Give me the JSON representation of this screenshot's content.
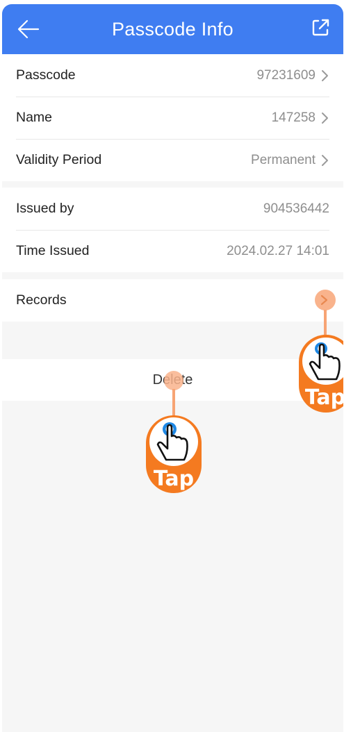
{
  "header": {
    "title": "Passcode Info",
    "back_icon": "arrow-left-icon",
    "share_icon": "external-link-icon",
    "color": "#3f7df1"
  },
  "info": [
    {
      "label": "Passcode",
      "value": "97231609",
      "chevron": true
    },
    {
      "label": "Name",
      "value": "147258",
      "chevron": true
    },
    {
      "label": "Validity Period",
      "value": "Permanent",
      "chevron": true
    }
  ],
  "issue": [
    {
      "label": "Issued by",
      "value": "904536442"
    },
    {
      "label": "Time Issued",
      "value": "2024.02.27 14:01"
    }
  ],
  "records": {
    "label": "Records"
  },
  "delete": {
    "label": "Delete"
  },
  "tap_hints": {
    "label": "Tap",
    "color": "#f47a20"
  }
}
